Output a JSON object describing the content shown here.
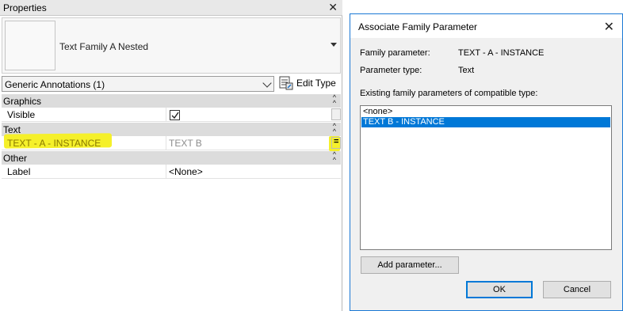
{
  "properties": {
    "title": "Properties",
    "type_name": "Text Family A Nested",
    "instance_filter": "Generic Annotations (1)",
    "edit_type_label": "Edit Type",
    "groups": {
      "graphics": "Graphics",
      "text": "Text",
      "other": "Other"
    },
    "rows": {
      "visible_label": "Visible",
      "visible_checked": true,
      "text_param_label": "TEXT - A - INSTANCE",
      "text_param_value": "TEXT B",
      "label_label": "Label",
      "label_value": "<None>"
    },
    "highlight_color": "#f5f02a"
  },
  "dialog": {
    "title": "Associate Family Parameter",
    "family_param_label": "Family parameter:",
    "family_param_value": "TEXT - A - INSTANCE",
    "param_type_label": "Parameter type:",
    "param_type_value": "Text",
    "existing_label": "Existing family parameters of compatible type:",
    "list_items": [
      "<none>",
      "TEXT B - INSTANCE"
    ],
    "selected_index": 1,
    "add_parameter_label": "Add parameter...",
    "ok_label": "OK",
    "cancel_label": "Cancel",
    "accent_color": "#0078d7"
  }
}
